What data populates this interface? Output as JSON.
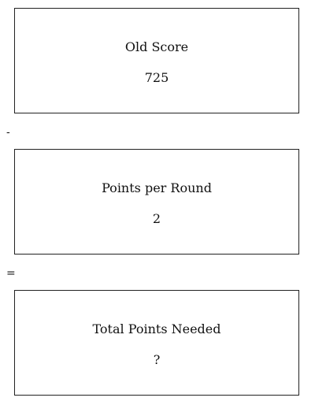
{
  "cards": [
    {
      "label": "Old Score",
      "value": "725"
    },
    {
      "label": "Points per Round",
      "value": "2"
    },
    {
      "label": "Total Points Needed",
      "value": "?"
    }
  ],
  "operators": [
    "-",
    "="
  ]
}
